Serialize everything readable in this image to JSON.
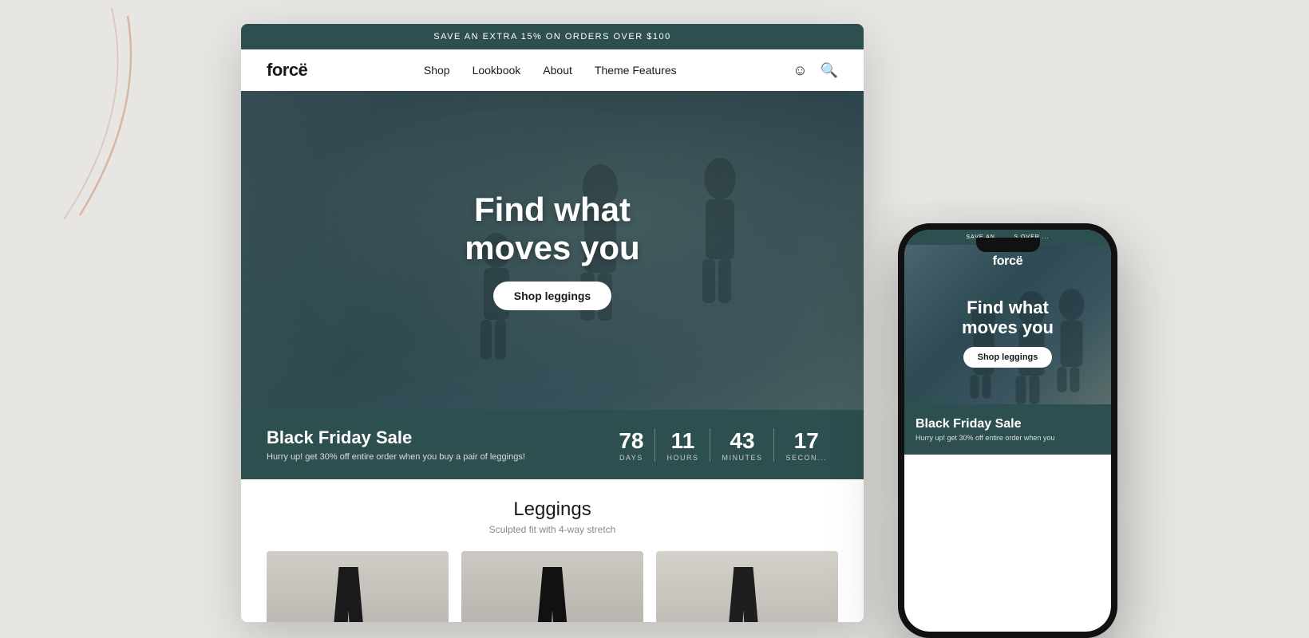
{
  "background": {
    "color": "#e8e6e3"
  },
  "desktop": {
    "announcement": "SAVE AN EXTRA 15% ON ORDERS OVER $100",
    "nav": {
      "logo": "forcë",
      "links": [
        "Shop",
        "Lookbook",
        "About",
        "Theme Features"
      ]
    },
    "hero": {
      "title_line1": "Find what",
      "title_line2": "moves you",
      "cta_button": "Shop leggings"
    },
    "countdown": {
      "title": "Black Friday Sale",
      "subtitle": "Hurry up! get 30% off entire order when you buy a pair of leggings!",
      "days": {
        "value": "78",
        "label": "DAYS"
      },
      "hours": {
        "value": "11",
        "label": "HOURS"
      },
      "minutes": {
        "value": "43",
        "label": "MINUTES"
      },
      "seconds": {
        "value": "17",
        "label": "SECON..."
      }
    },
    "products": {
      "title": "Leggings",
      "subtitle": "Sculpted fit with 4-way stretch"
    }
  },
  "phone": {
    "announcement": "SAVE AN   S OVER ...",
    "logo": "forcë",
    "hero": {
      "title_line1": "Find what",
      "title_line2": "moves you",
      "cta_button": "Shop leggings"
    },
    "countdown": {
      "title": "Black Friday Sale",
      "subtitle": "Hurry up! get 30% off entire order when you"
    }
  }
}
